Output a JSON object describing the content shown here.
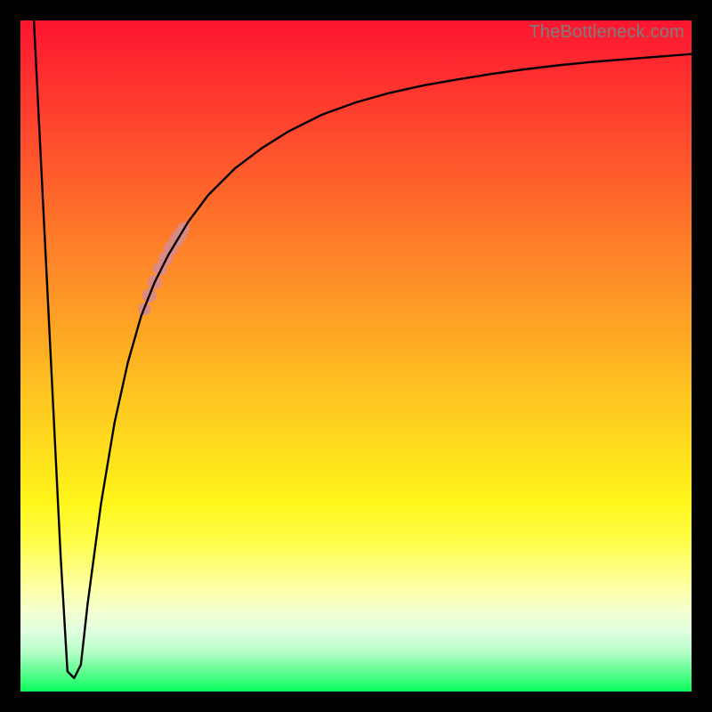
{
  "watermark": "TheBottleneck.com",
  "colors": {
    "frame": "#000000",
    "curve": "#000000",
    "marker": "#da8983",
    "watermark": "#7d7d7d"
  },
  "chart_data": {
    "type": "line",
    "title": "",
    "xlabel": "",
    "ylabel": "",
    "xlim": [
      0,
      100
    ],
    "ylim": [
      0,
      100
    ],
    "grid": false,
    "legend": false,
    "series": [
      {
        "name": "bottleneck-curve",
        "x": [
          2,
          4,
          6,
          7,
          8,
          9,
          10,
          12,
          14,
          16,
          18,
          20,
          22,
          25,
          28,
          32,
          36,
          40,
          45,
          50,
          55,
          60,
          65,
          70,
          75,
          80,
          85,
          90,
          95,
          100
        ],
        "y": [
          100,
          60,
          20,
          3,
          2,
          4,
          13,
          28,
          40,
          49,
          56,
          61,
          65,
          70,
          74,
          78,
          81,
          83.5,
          86,
          87.8,
          89.2,
          90.3,
          91.2,
          92,
          92.7,
          93.3,
          93.8,
          94.2,
          94.6,
          95
        ]
      }
    ],
    "markers": {
      "name": "highlight-segment",
      "color": "#da8983",
      "points_x": [
        18.5,
        19.2,
        20.0,
        20.8,
        21.6,
        22.4,
        23.2,
        23.7,
        24.3
      ],
      "points_y": [
        57,
        59,
        61,
        63,
        64.5,
        66,
        67.2,
        68,
        69
      ]
    },
    "gradient_stops": [
      {
        "pos": 0,
        "color": "#fd1530"
      },
      {
        "pos": 8,
        "color": "#fe2e2f"
      },
      {
        "pos": 16,
        "color": "#fe472e"
      },
      {
        "pos": 24,
        "color": "#fe602b"
      },
      {
        "pos": 32,
        "color": "#fe7a29"
      },
      {
        "pos": 40,
        "color": "#fe9327"
      },
      {
        "pos": 48,
        "color": "#feac23"
      },
      {
        "pos": 56,
        "color": "#fec521"
      },
      {
        "pos": 64,
        "color": "#ffde1d"
      },
      {
        "pos": 72,
        "color": "#fff61a"
      },
      {
        "pos": 78,
        "color": "#fffe4f"
      },
      {
        "pos": 84,
        "color": "#fdff9e"
      },
      {
        "pos": 88,
        "color": "#f4ffd0"
      },
      {
        "pos": 91,
        "color": "#e0ffdf"
      },
      {
        "pos": 94,
        "color": "#b7feca"
      },
      {
        "pos": 96,
        "color": "#7efda4"
      },
      {
        "pos": 98,
        "color": "#44fd80"
      },
      {
        "pos": 100,
        "color": "#07fc5b"
      }
    ]
  }
}
